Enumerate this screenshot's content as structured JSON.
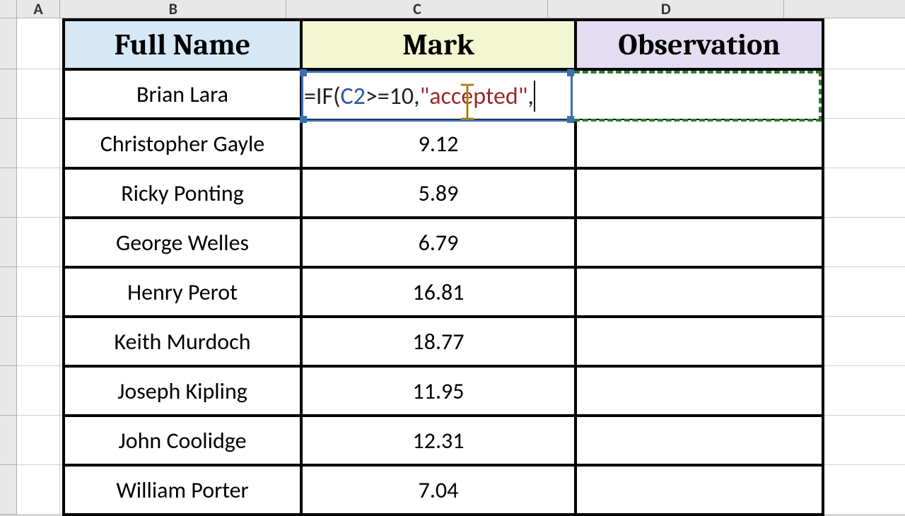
{
  "columns": {
    "A": "A",
    "B": "B",
    "C": "C",
    "D": "D",
    "E": ""
  },
  "headers": {
    "name": "Full Name",
    "mark": "Mark",
    "obs": "Observation"
  },
  "formula": {
    "prefix": "=IF(",
    "ref": "C2",
    "mid1": ">=10,",
    "str": "\"accepted\"",
    "mid2": ",",
    "full": "=IF(C2>=10,\"accepted\","
  },
  "rows": [
    {
      "name": "Brian Lara",
      "mark": "",
      "obs": ""
    },
    {
      "name": "Christopher Gayle",
      "mark": "9.12",
      "obs": ""
    },
    {
      "name": "Ricky Ponting",
      "mark": "5.89",
      "obs": ""
    },
    {
      "name": "George Welles",
      "mark": "6.79",
      "obs": ""
    },
    {
      "name": "Henry Perot",
      "mark": "16.81",
      "obs": ""
    },
    {
      "name": "Keith Murdoch",
      "mark": "18.77",
      "obs": ""
    },
    {
      "name": "Joseph Kipling",
      "mark": "11.95",
      "obs": ""
    },
    {
      "name": "John Coolidge",
      "mark": "12.31",
      "obs": ""
    },
    {
      "name": "William Porter",
      "mark": "7.04",
      "obs": ""
    }
  ],
  "chart_data": {
    "type": "table",
    "columns": [
      "Full Name",
      "Mark",
      "Observation"
    ],
    "rows": [
      [
        "Brian Lara",
        null,
        ""
      ],
      [
        "Christopher Gayle",
        9.12,
        ""
      ],
      [
        "Ricky Ponting",
        5.89,
        ""
      ],
      [
        "George Welles",
        6.79,
        ""
      ],
      [
        "Henry Perot",
        16.81,
        ""
      ],
      [
        "Keith Murdoch",
        18.77,
        ""
      ],
      [
        "Joseph Kipling",
        11.95,
        ""
      ],
      [
        "John Coolidge",
        12.31,
        ""
      ],
      [
        "William Porter",
        7.04,
        ""
      ]
    ]
  }
}
